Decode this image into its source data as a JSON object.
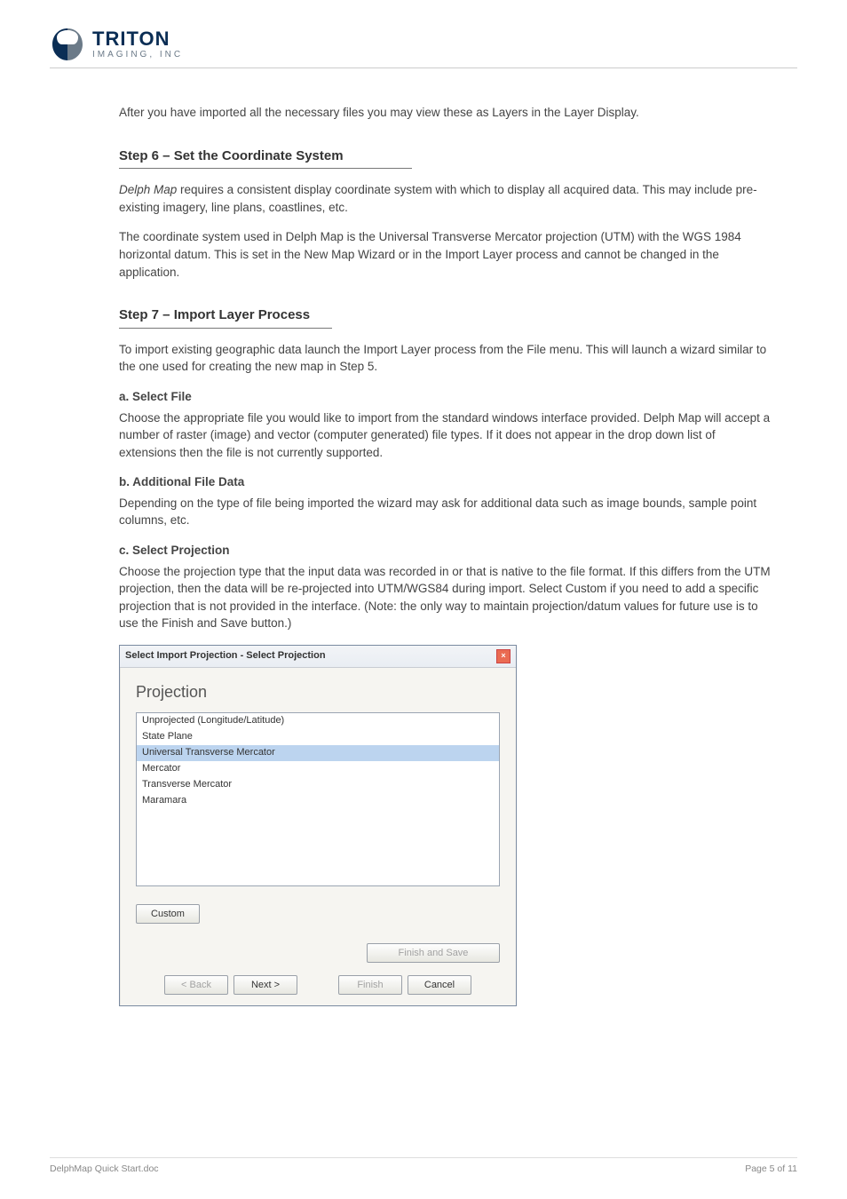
{
  "header": {
    "brand_line1": "TRITON",
    "brand_line2": "IMAGING, INC"
  },
  "intro": "After you have imported all the necessary files you may view these as Layers in the Layer Display.",
  "sec1": {
    "heading": "Step 6 – Set the Coordinate System",
    "p1_a": "Delph Map",
    "p1_b": " requires a consistent display coordinate system with which to display all acquired data.  This may include pre-existing imagery, line plans, coastlines, etc.",
    "p2": "The coordinate system used in Delph Map is the Universal Transverse Mercator projection (UTM) with the WGS 1984 horizontal datum.  This is set in the New Map Wizard or in the Import Layer process and cannot be changed in the application."
  },
  "sec2": {
    "heading": "Step 7 – Import Layer Process",
    "p1": "To import existing geographic data launch the Import Layer process from the File menu.  This will launch a wizard similar to the one used for creating the new map in Step 5.",
    "list": {
      "a_t": "a. Select File",
      "a_b": "Choose the appropriate file you would like to import from the standard windows interface provided.  Delph Map will accept a number of raster (image) and vector (computer generated) file types.  If it does not appear in the drop down list of extensions then the file is not currently supported.",
      "b_t": "b. Additional File Data",
      "b_b": "Depending on the type of file being imported the wizard may ask for additional data such as image bounds, sample point columns, etc.",
      "c_t": "c. Select Projection",
      "c_b": "Choose the projection type that the input data was recorded in or that is native to the file format.  If this differs from the UTM projection, then the data will be re-projected into UTM/WGS84 during import.  Select Custom if you need to add a specific projection that is not provided in the interface.  (Note: the only way to maintain projection/datum values for future use is to use the Finish and Save button.)"
    }
  },
  "dialog": {
    "title": "Select Import Projection - Select Projection",
    "proj_label": "Projection",
    "items": [
      "Unprojected (Longitude/Latitude)",
      "State Plane",
      "Universal Transverse Mercator",
      "Mercator",
      "Transverse Mercator",
      "Maramara"
    ],
    "custom": "Custom",
    "finish_save": "Finish and Save",
    "back": "< Back",
    "next": "Next >",
    "finish": "Finish",
    "cancel": "Cancel"
  },
  "footer": {
    "left": "DelphMap Quick Start.doc",
    "right": "Page 5 of 11"
  }
}
